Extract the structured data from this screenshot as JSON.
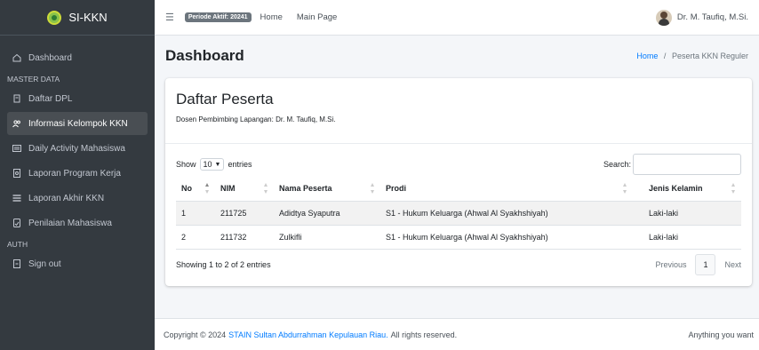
{
  "brand": {
    "name": "SI-KKN"
  },
  "sidebar": {
    "items": [
      {
        "label": "Dashboard",
        "icon": "home-icon"
      },
      {
        "header": "MASTER DATA"
      },
      {
        "label": "Daftar DPL",
        "icon": "file-icon"
      },
      {
        "label": "Informasi Kelompok KKN",
        "icon": "users-icon",
        "active": true
      },
      {
        "label": "Daily Activity Mahasiswa",
        "icon": "list-icon"
      },
      {
        "label": "Laporan Program Kerja",
        "icon": "document-icon"
      },
      {
        "label": "Laporan Akhir KKN",
        "icon": "report-icon"
      },
      {
        "label": "Penilaian Mahasiswa",
        "icon": "grade-icon"
      },
      {
        "header": "AUTH"
      },
      {
        "label": "Sign out",
        "icon": "signout-icon"
      }
    ]
  },
  "topbar": {
    "periode": "Periode Aktif: 20241",
    "home": "Home",
    "main_page": "Main Page",
    "user": "Dr. M. Taufiq, M.Si."
  },
  "content": {
    "title": "Dashboard",
    "breadcrumb_home": "Home",
    "breadcrumb_sep": "/",
    "breadcrumb_current": "Peserta KKN Reguler"
  },
  "card": {
    "title": "Daftar Peserta",
    "subtitle": "Dosen Pembimbing Lapangan: Dr. M. Taufiq, M.Si.",
    "show_label": "Show",
    "show_value": "10",
    "entries_label": "entries",
    "search_label": "Search:",
    "search_value": "",
    "columns": [
      "No",
      "NIM",
      "Nama Peserta",
      "Prodi",
      "Jenis Kelamin"
    ],
    "rows": [
      [
        "1",
        "211725",
        "Adidtya Syaputra",
        "S1 - Hukum Keluarga (Ahwal Al Syakhshiyah)",
        "Laki-laki"
      ],
      [
        "2",
        "211732",
        "Zulkifli",
        "S1 - Hukum Keluarga (Ahwal Al Syakhshiyah)",
        "Laki-laki"
      ]
    ],
    "info": "Showing 1 to 2 of 2 entries",
    "previous": "Previous",
    "page": "1",
    "next": "Next"
  },
  "footer": {
    "copyright": "Copyright © 2024",
    "link": "STAIN Sultan Abdurrahman Kepulauan Riau.",
    "rights": "All rights reserved.",
    "right_text": "Anything you want"
  },
  "colors": {
    "sidebar": "#343a40",
    "accent": "#007bff",
    "active_item": "#494e53"
  }
}
